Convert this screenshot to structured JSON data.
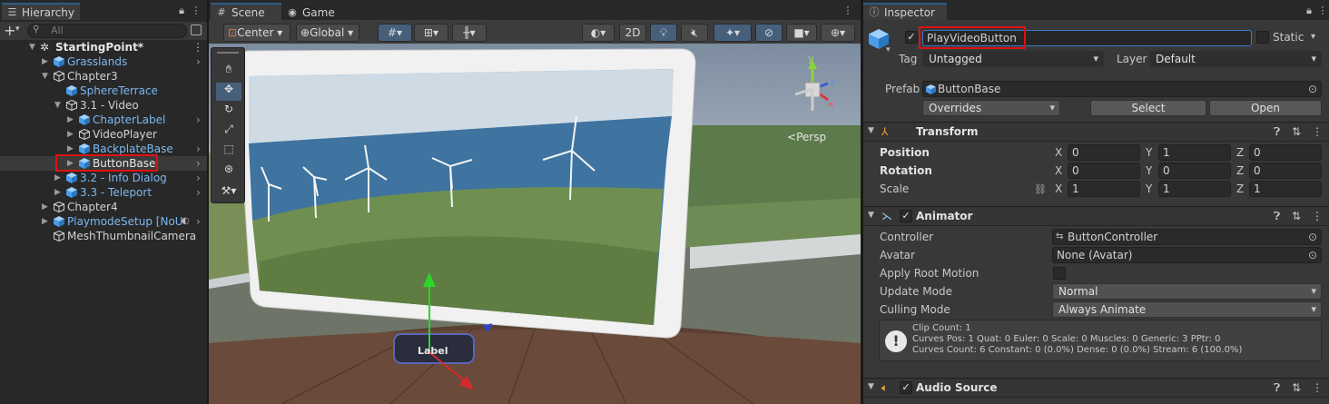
{
  "hierarchy": {
    "tab_label": "Hierarchy",
    "search_placeholder": "All",
    "items": [
      {
        "label": "StartingPoint*"
      },
      {
        "label": "Grasslands"
      },
      {
        "label": "Chapter3"
      },
      {
        "label": "SphereTerrace"
      },
      {
        "label": "3.1 - Video"
      },
      {
        "label": "ChapterLabel"
      },
      {
        "label": "VideoPlayer"
      },
      {
        "label": "BackplateBase"
      },
      {
        "label": "ButtonBase"
      },
      {
        "label": "3.2 - Info Dialog"
      },
      {
        "label": "3.3 - Teleport"
      },
      {
        "label": "Chapter4"
      },
      {
        "label": "PlaymodeSetup [NoUp"
      },
      {
        "label": "MeshThumbnailCamera"
      }
    ]
  },
  "scene": {
    "tab_scene": "Scene",
    "tab_game": "Game",
    "pivot": "Center",
    "space": "Global",
    "mode_2d": "2D",
    "persp": "Persp",
    "button_label": "Label",
    "gizmo_axes": [
      "y",
      "x",
      "z"
    ]
  },
  "inspector": {
    "tab_label": "Inspector",
    "object_name": "PlayVideoButton",
    "static_label": "Static",
    "tag_label": "Tag",
    "tag_value": "Untagged",
    "layer_label": "Layer",
    "layer_value": "Default",
    "prefab_label": "Prefab",
    "prefab_value": "ButtonBase",
    "overrides": "Overrides",
    "select": "Select",
    "open": "Open",
    "transform": {
      "title": "Transform",
      "position_label": "Position",
      "rotation_label": "Rotation",
      "scale_label": "Scale",
      "x": "X",
      "y": "Y",
      "z": "Z",
      "position": [
        "0",
        "1",
        "0"
      ],
      "rotation": [
        "0",
        "0",
        "0"
      ],
      "scale": [
        "1",
        "1",
        "1"
      ]
    },
    "animator": {
      "title": "Animator",
      "controller_label": "Controller",
      "controller_value": "ButtonController",
      "avatar_label": "Avatar",
      "avatar_value": "None (Avatar)",
      "root_motion_label": "Apply Root Motion",
      "update_mode_label": "Update Mode",
      "update_mode_value": "Normal",
      "culling_mode_label": "Culling Mode",
      "culling_mode_value": "Always Animate",
      "info_lines": [
        "Clip Count: 1",
        "Curves Pos: 1 Quat: 0 Euler: 0 Scale: 0 Muscles: 0 Generic: 3 PPtr: 0",
        "Curves Count: 6 Constant: 0 (0.0%) Dense: 0 (0.0%) Stream: 6 (100.0%)"
      ]
    },
    "audio": {
      "title": "Audio Source"
    }
  },
  "colors": {
    "accent": "#2c5d87",
    "selection_box": "#e01010",
    "link_blue": "#7cb8f0"
  }
}
